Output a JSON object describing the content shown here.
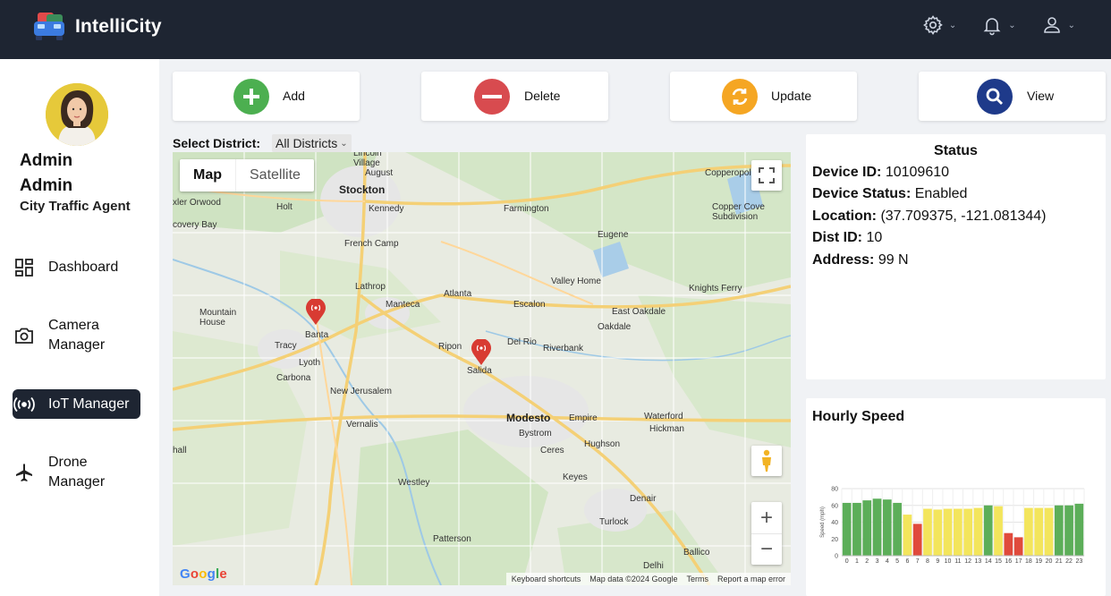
{
  "app": {
    "name": "IntelliCity"
  },
  "header": {
    "icons": [
      "gear-icon",
      "bell-icon",
      "user-icon"
    ]
  },
  "user": {
    "first_name": "Admin",
    "last_name": "Admin",
    "role": "City Traffic Agent"
  },
  "nav": {
    "items": [
      {
        "label": "Dashboard",
        "icon": "dashboard-icon",
        "active": false
      },
      {
        "label": "Camera Manager",
        "icon": "camera-icon",
        "active": false
      },
      {
        "label": "IoT Manager",
        "icon": "iot-icon",
        "active": true
      },
      {
        "label": "Drone Manager",
        "icon": "plane-icon",
        "active": false
      }
    ]
  },
  "actions": {
    "add": {
      "label": "Add",
      "color": "#4caf50"
    },
    "delete": {
      "label": "Delete",
      "color": "#d84b4f"
    },
    "update": {
      "label": "Update",
      "color": "#f5a623"
    },
    "view": {
      "label": "View",
      "color": "#1e3a8a"
    }
  },
  "district": {
    "label": "Select District:",
    "selected": "All Districts"
  },
  "map": {
    "toggle": {
      "map": "Map",
      "satellite": "Satellite"
    },
    "selected_view": "Map",
    "google": "Google",
    "footer": [
      "Keyboard shortcuts",
      "Map data ©2024 Google",
      "Terms",
      "Report a map error"
    ],
    "cities": {
      "stockton": "Stockton",
      "lincoln_village": "Lincoln\nVillage",
      "august": "August",
      "copperopolis": "Copperopol",
      "orwood": "xler Orwood",
      "holt": "Holt",
      "kennedy": "Kennedy",
      "farmington": "Farmington",
      "copper_cove": "Copper Cove\nSubdivision",
      "discovery_bay": "covery Bay",
      "french_camp": "French Camp",
      "eugene": "Eugene",
      "lathrop": "Lathrop",
      "atlanta": "Atlanta",
      "valley_home": "Valley Home",
      "knights_ferry": "Knights Ferry",
      "mountain_house": "Mountain\nHouse",
      "manteca": "Manteca",
      "escalon": "Escalon",
      "east_oakdale": "East Oakdale",
      "oakdale": "Oakdale",
      "banta": "Banta",
      "tracy": "Tracy",
      "lyoth": "Lyoth",
      "ripon": "Ripon",
      "del_rio": "Del Rio",
      "riverbank": "Riverbank",
      "salida": "Salida",
      "carbona": "Carbona",
      "new_jerusalem": "New Jerusalem",
      "modesto": "Modesto",
      "empire": "Empire",
      "waterford": "Waterford",
      "hickman": "Hickman",
      "vernalis": "Vernalis",
      "bystrom": "Bystrom",
      "hughson": "Hughson",
      "ceres": "Ceres",
      "keyes": "Keyes",
      "westley": "Westley",
      "denair": "Denair",
      "turlock": "Turlock",
      "patterson": "Patterson",
      "ballico": "Ballico",
      "delhi": "Delhi",
      "hall": "hall"
    }
  },
  "status": {
    "title": "Status",
    "device_id_label": "Device ID:",
    "device_id": "10109610",
    "device_status_label": "Device Status:",
    "device_status": "Enabled",
    "location_label": "Location:",
    "location": "(37.709375, -121.081344)",
    "dist_id_label": "Dist ID:",
    "dist_id": "10",
    "address_label": "Address:",
    "address": "99 N"
  },
  "hourly_speed": {
    "title": "Hourly Speed"
  },
  "chart_data": {
    "type": "bar",
    "title": "",
    "xlabel": "",
    "ylabel": "Speed (mph)",
    "ylim": [
      0,
      80
    ],
    "yticks": [
      0,
      20,
      40,
      60,
      80
    ],
    "grid": true,
    "categories": [
      "0",
      "1",
      "2",
      "3",
      "4",
      "5",
      "6",
      "7",
      "8",
      "9",
      "10",
      "11",
      "12",
      "13",
      "14",
      "15",
      "16",
      "17",
      "18",
      "19",
      "20",
      "21",
      "22",
      "23"
    ],
    "values": [
      63,
      63,
      66,
      68,
      67,
      63,
      49,
      38,
      56,
      55,
      56,
      56,
      56,
      57,
      60,
      59,
      27,
      22,
      57,
      57,
      57,
      60,
      60,
      62
    ],
    "colors": [
      "#5cae59",
      "#5cae59",
      "#5cae59",
      "#5cae59",
      "#5cae59",
      "#5cae59",
      "#f3e55c",
      "#e04a3c",
      "#f3e55c",
      "#f3e55c",
      "#f3e55c",
      "#f3e55c",
      "#f3e55c",
      "#f3e55c",
      "#5cae59",
      "#f3e55c",
      "#e04a3c",
      "#e04a3c",
      "#f3e55c",
      "#f3e55c",
      "#f3e55c",
      "#5cae59",
      "#5cae59",
      "#5cae59"
    ]
  }
}
